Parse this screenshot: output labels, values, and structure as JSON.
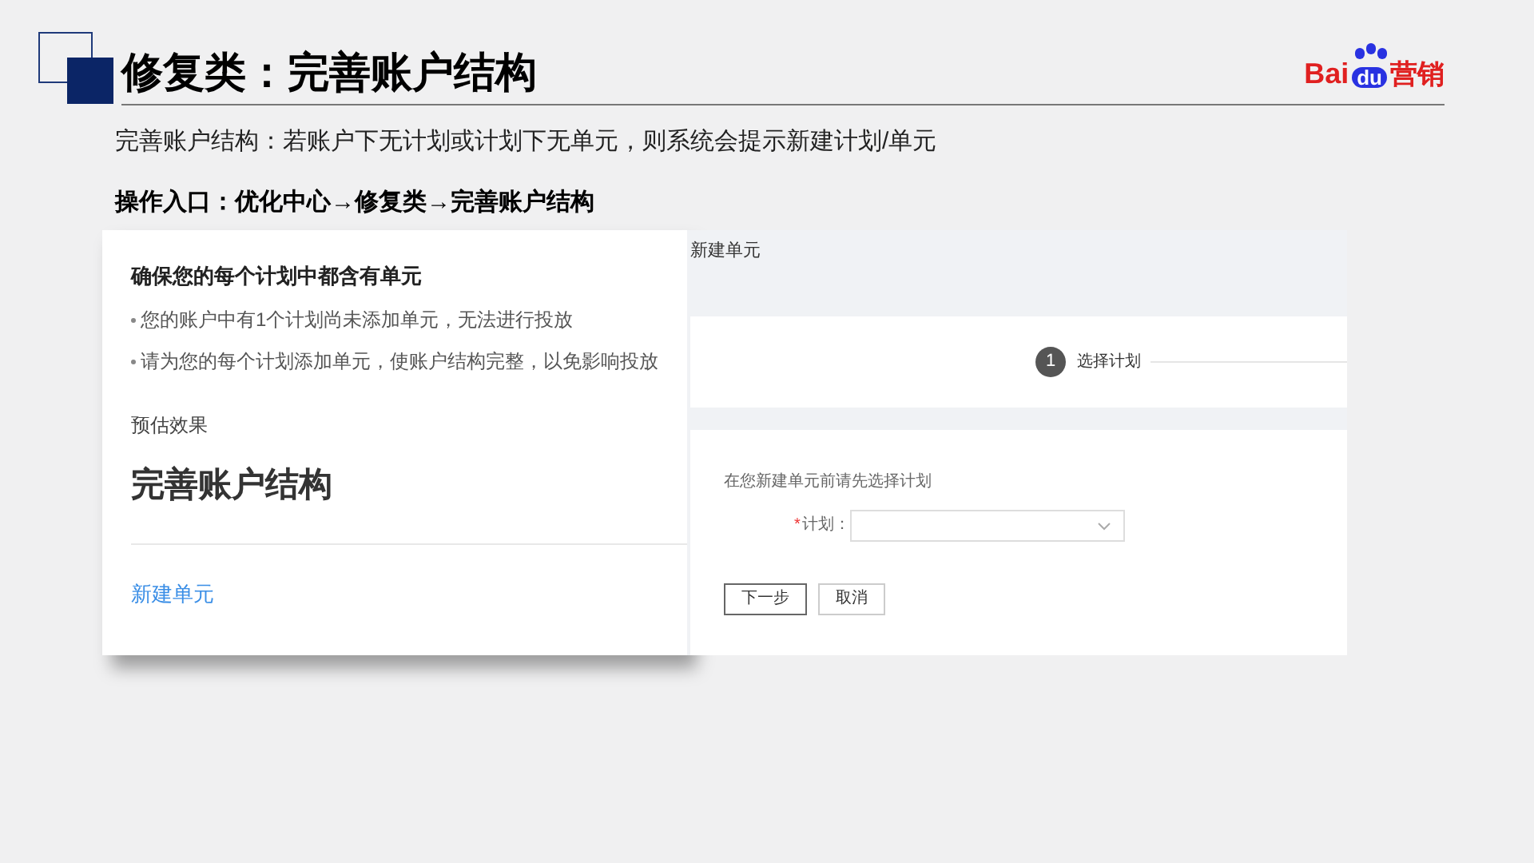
{
  "header": {
    "title": "修复类：完善账户结构",
    "logo": {
      "prefix": "Bai",
      "badge": "du",
      "suffix": "营销"
    }
  },
  "description": "完善账户结构：若账户下无计划或计划下无单元，则系统会提示新建计划/单元",
  "entry": "操作入口：优化中心→修复类→完善账户结构",
  "suggestion_card": {
    "heading": "确保您的每个计划中都含有单元",
    "bullets": [
      "您的账户中有1个计划尚未添加单元，无法进行投放",
      "请为您的每个计划添加单元，使账户结构完整，以免影响投放"
    ],
    "effect_label": "预估效果",
    "effect_value": "完善账户结构",
    "action_link": "新建单元"
  },
  "create_panel": {
    "title": "新建单元",
    "steps": [
      {
        "number": "1",
        "label": "选择计划",
        "selected": true
      }
    ],
    "hint": "在您新建单元前请先选择计划",
    "field": {
      "required_mark": "*",
      "label": "计划："
    },
    "buttons": [
      {
        "label": "下一步",
        "kind": "primary"
      },
      {
        "label": "取消",
        "kind": "default"
      }
    ]
  }
}
